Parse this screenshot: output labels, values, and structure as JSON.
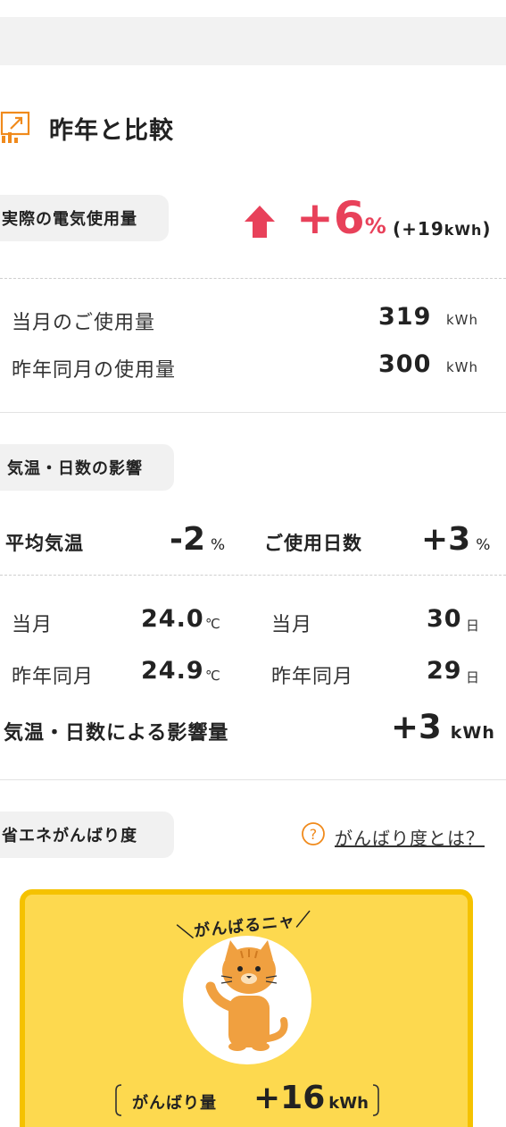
{
  "section": {
    "title": "昨年と比較"
  },
  "actual": {
    "pill": "実際の電気使用量",
    "change": "+6",
    "change_unit": "%",
    "delta": "(+19",
    "delta_unit": "kWh",
    "delta_close": ")"
  },
  "usage": {
    "current_label": "当月のご使用量",
    "current_value": "319",
    "prev_label": "昨年同月の使用量",
    "prev_value": "300",
    "unit": "kWh"
  },
  "weather": {
    "pill": "気温・日数の影響",
    "temp_label": "平均気温",
    "temp_change": "-2",
    "days_label": "ご使用日数",
    "days_change": "+3",
    "percent": "%",
    "month_label": "当月",
    "prev_label": "昨年同月",
    "temp_current": "24.0",
    "temp_prev": "24.9",
    "temp_unit": "℃",
    "days_current": "30",
    "days_prev": "29",
    "days_unit": "日",
    "impact_label": "気温・日数による影響量",
    "impact_value": "+3",
    "impact_unit": "kWh"
  },
  "effort": {
    "pill": "省エネがんばり度",
    "help_link": "がんばり度とは？",
    "banner": "＼がんばるニャ／",
    "amount_label": "がんばり量",
    "amount_value": "+16",
    "amount_unit": "kWh"
  },
  "colors": {
    "accent_red": "#e8415a",
    "accent_orange": "#f08a1c",
    "card_yellow": "#fdd94f",
    "card_border": "#f5c200"
  },
  "icons": {
    "section_icon": "chart-compare-icon",
    "arrow": "arrow-up-icon",
    "help": "question-circle-icon",
    "mascot": "cat-mascot-icon"
  }
}
